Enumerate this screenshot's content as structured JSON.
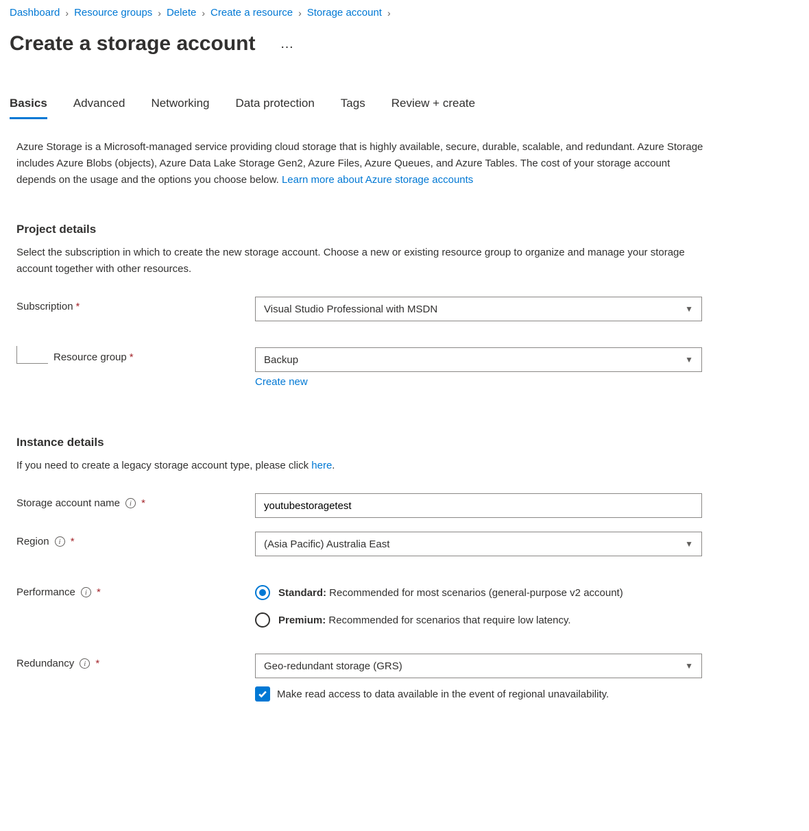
{
  "breadcrumb": [
    "Dashboard",
    "Resource groups",
    "Delete",
    "Create a resource",
    "Storage account"
  ],
  "page_title": "Create a storage account",
  "tabs": [
    {
      "label": "Basics",
      "active": true
    },
    {
      "label": "Advanced",
      "active": false
    },
    {
      "label": "Networking",
      "active": false
    },
    {
      "label": "Data protection",
      "active": false
    },
    {
      "label": "Tags",
      "active": false
    },
    {
      "label": "Review + create",
      "active": false
    }
  ],
  "intro_text": "Azure Storage is a Microsoft-managed service providing cloud storage that is highly available, secure, durable, scalable, and redundant. Azure Storage includes Azure Blobs (objects), Azure Data Lake Storage Gen2, Azure Files, Azure Queues, and Azure Tables. The cost of your storage account depends on the usage and the options you choose below. ",
  "intro_link": "Learn more about Azure storage accounts",
  "project_details": {
    "header": "Project details",
    "desc": "Select the subscription in which to create the new storage account. Choose a new or existing resource group to organize and manage your storage account together with other resources.",
    "subscription_label": "Subscription",
    "subscription_value": "Visual Studio Professional with MSDN",
    "resource_group_label": "Resource group",
    "resource_group_value": "Backup",
    "resource_group_new_link": "Create new"
  },
  "instance_details": {
    "header": "Instance details",
    "desc_1": "If you need to create a legacy storage account type, please click ",
    "desc_link": "here",
    "desc_2": ".",
    "name_label": "Storage account name",
    "name_value": "youtubestoragetest",
    "region_label": "Region",
    "region_value": "(Asia Pacific) Australia East",
    "perf_label": "Performance",
    "perf_options": {
      "standard_bold": "Standard:",
      "standard_rest": " Recommended for most scenarios (general-purpose v2 account)",
      "premium_bold": "Premium:",
      "premium_rest": " Recommended for scenarios that require low latency."
    },
    "redundancy_label": "Redundancy",
    "redundancy_value": "Geo-redundant storage (GRS)",
    "redundancy_check_label": "Make read access to data available in the event of regional unavailability."
  }
}
